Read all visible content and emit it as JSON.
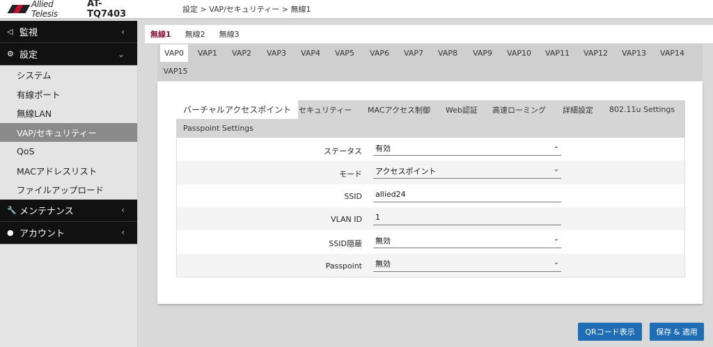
{
  "header": {
    "logo_text": "Allied Telesis",
    "model": "AT-TQ7403",
    "breadcrumb": "設定 > VAP/セキュリティー > 無線1"
  },
  "sidebar": {
    "monitor": "監視",
    "settings": "設定",
    "items": [
      "システム",
      "有線ポート",
      "無線LAN",
      "VAP/セキュリティー",
      "QoS",
      "MACアドレスリスト",
      "ファイルアップロード"
    ],
    "maintenance": "メンテナンス",
    "account": "アカウント"
  },
  "wireless_tabs": [
    "無線1",
    "無線2",
    "無線3"
  ],
  "vap_tabs": [
    "VAP0",
    "VAP1",
    "VAP2",
    "VAP3",
    "VAP4",
    "VAP5",
    "VAP6",
    "VAP7",
    "VAP8",
    "VAP9",
    "VAP10",
    "VAP11",
    "VAP12",
    "VAP13",
    "VAP14",
    "VAP15"
  ],
  "sub_tabs": [
    "バーチャルアクセスポイント",
    "セキュリティー",
    "MACアクセス制御",
    "Web認証",
    "高速ローミング",
    "詳細設定",
    "802.11u Settings",
    "Passpoint Settings"
  ],
  "form": {
    "status": {
      "label": "ステータス",
      "value": "有効"
    },
    "mode": {
      "label": "モード",
      "value": "アクセスポイント"
    },
    "ssid": {
      "label": "SSID",
      "value": "allied24"
    },
    "vlan": {
      "label": "VLAN ID",
      "value": "1"
    },
    "ssid_hidden": {
      "label": "SSID隠蔽",
      "value": "無効"
    },
    "passpoint": {
      "label": "Passpoint",
      "value": "無効"
    }
  },
  "buttons": {
    "qr": "QRコード表示",
    "save": "保存 & 適用"
  },
  "colors": {
    "accent": "#1f6db5",
    "active_wireless_tab": "#8b1530",
    "brand_red": "#c8102e"
  }
}
